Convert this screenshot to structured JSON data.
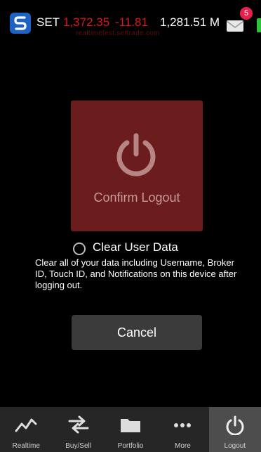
{
  "header": {
    "market": "SET",
    "index_value": "1,372.35",
    "index_change": "-11.81",
    "volume": "1,281.51 M",
    "subtitle": "realtimetest.settrade.com",
    "mail_badge": "5"
  },
  "dialog": {
    "confirm_label": "Confirm Logout",
    "clear_label": "Clear User Data",
    "clear_description": "Clear all of your data including Username, Broker ID, Touch ID, and Notifications on this device after logging out.",
    "cancel_label": "Cancel"
  },
  "tabs": [
    {
      "label": "Realtime",
      "icon": "chart-line-icon"
    },
    {
      "label": "Buy/Sell",
      "icon": "swap-arrows-icon"
    },
    {
      "label": "Portfolio",
      "icon": "folder-icon"
    },
    {
      "label": "More",
      "icon": "more-dots-icon"
    },
    {
      "label": "Logout",
      "icon": "power-icon",
      "active": true
    }
  ],
  "colors": {
    "negative": "#e0161b",
    "logout_card": "#6b1c1c",
    "badge": "#e8204e"
  }
}
